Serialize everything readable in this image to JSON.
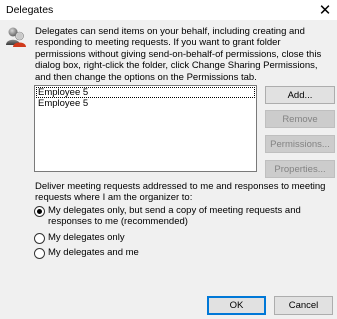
{
  "window": {
    "title": "Delegates",
    "close_glyph": "✕"
  },
  "intro_text": "Delegates can send items on your behalf, including creating and responding to meeting requests. If you want to grant folder permissions without giving send-on-behalf-of permissions, close this dialog box, right-click the folder, click Change Sharing Permissions, and then change the options on the Permissions tab.",
  "delegates_list": {
    "items": [
      "Employee 5",
      "Employee 5"
    ],
    "focused_index": 0
  },
  "side_buttons": {
    "add": "Add...",
    "remove": "Remove",
    "permissions": "Permissions...",
    "properties": "Properties..."
  },
  "deliver": {
    "label": "Deliver meeting requests addressed to me and responses to meeting requests where I am the organizer to:",
    "options": [
      {
        "label": "My delegates only, but send a copy of meeting requests and responses to me (recommended)",
        "checked": true
      },
      {
        "label": "My delegates only",
        "checked": false
      },
      {
        "label": "My delegates and me",
        "checked": false
      }
    ]
  },
  "footer": {
    "ok": "OK",
    "cancel": "Cancel"
  },
  "colors": {
    "dialog_bg": "#f0f0f0",
    "titlebar_bg": "#ffffff",
    "default_button_border": "#0078d7",
    "disabled_text": "#838383"
  },
  "icons": {
    "dialog_icon": "delegates-person-icon"
  }
}
